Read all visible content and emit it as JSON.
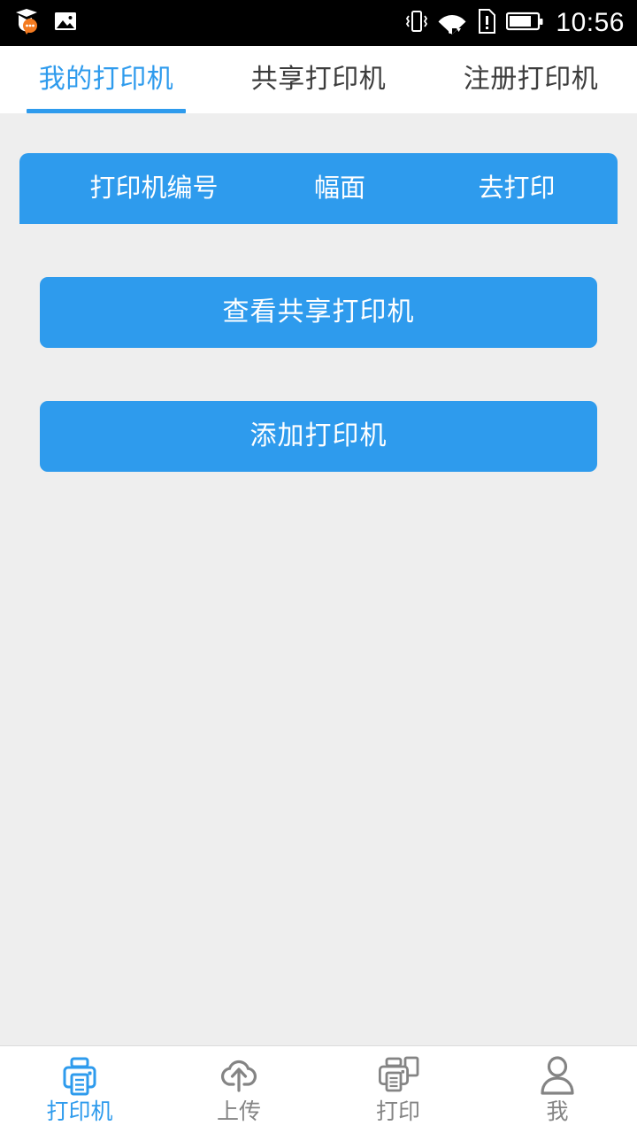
{
  "statusbar": {
    "time": "10:56",
    "left_icons": [
      {
        "name": "app-notification-icon",
        "glyph": "owl-chat"
      },
      {
        "name": "gallery-image-icon",
        "glyph": "picture"
      }
    ],
    "right_icons": [
      {
        "name": "vibrate-icon",
        "glyph": "vibrate"
      },
      {
        "name": "wifi-icon",
        "glyph": "wifi"
      },
      {
        "name": "sim-alert-icon",
        "glyph": "sim-card-alert"
      },
      {
        "name": "battery-icon",
        "glyph": "battery"
      }
    ]
  },
  "tabs": [
    {
      "label": "我的打印机",
      "active": true
    },
    {
      "label": "共享打印机",
      "active": false
    },
    {
      "label": "注册打印机",
      "active": false
    }
  ],
  "list_header": {
    "columns": [
      "打印机编号",
      "幅面",
      "去打印"
    ]
  },
  "actions": {
    "view_shared": "查看共享打印机",
    "add_printer": "添加打印机"
  },
  "bottom_nav": [
    {
      "label": "打印机",
      "icon": "printer-icon",
      "active": true
    },
    {
      "label": "上传",
      "icon": "cloud-upload-icon",
      "active": false
    },
    {
      "label": "打印",
      "icon": "print-document-icon",
      "active": false
    },
    {
      "label": "我",
      "icon": "person-icon",
      "active": false
    }
  ],
  "colors": {
    "accent": "#2e9bed",
    "page_background": "#eeeeee",
    "surface": "#ffffff",
    "statusbar_background": "#000000",
    "inactive_text": "#848484",
    "tab_text": "#3c3c3c"
  }
}
